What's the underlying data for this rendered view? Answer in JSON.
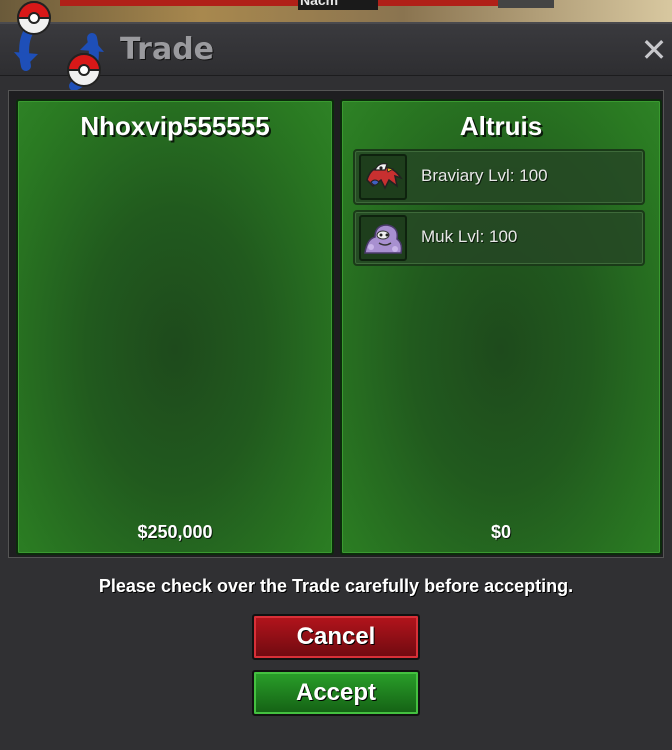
{
  "window": {
    "title": "Trade",
    "close_symbol": "✕",
    "background_name_fragment": "Nacm"
  },
  "trade": {
    "left": {
      "player_name": "Nhoxvip555555",
      "money": "$250,000",
      "pokemon": []
    },
    "right": {
      "player_name": "Altruis",
      "money": "$0",
      "pokemon": [
        {
          "label": "Braviary  Lvl: 100",
          "sprite_icon": "braviary-sprite-icon"
        },
        {
          "label": "Muk  Lvl: 100",
          "sprite_icon": "muk-sprite-icon"
        }
      ]
    }
  },
  "footer": {
    "warning": "Please check over the Trade carefully before accepting.",
    "cancel_label": "Cancel",
    "accept_label": "Accept"
  },
  "colors": {
    "panel_green": "#2a7a22",
    "cancel_red": "#b4141c",
    "accept_green": "#2aa02a"
  }
}
